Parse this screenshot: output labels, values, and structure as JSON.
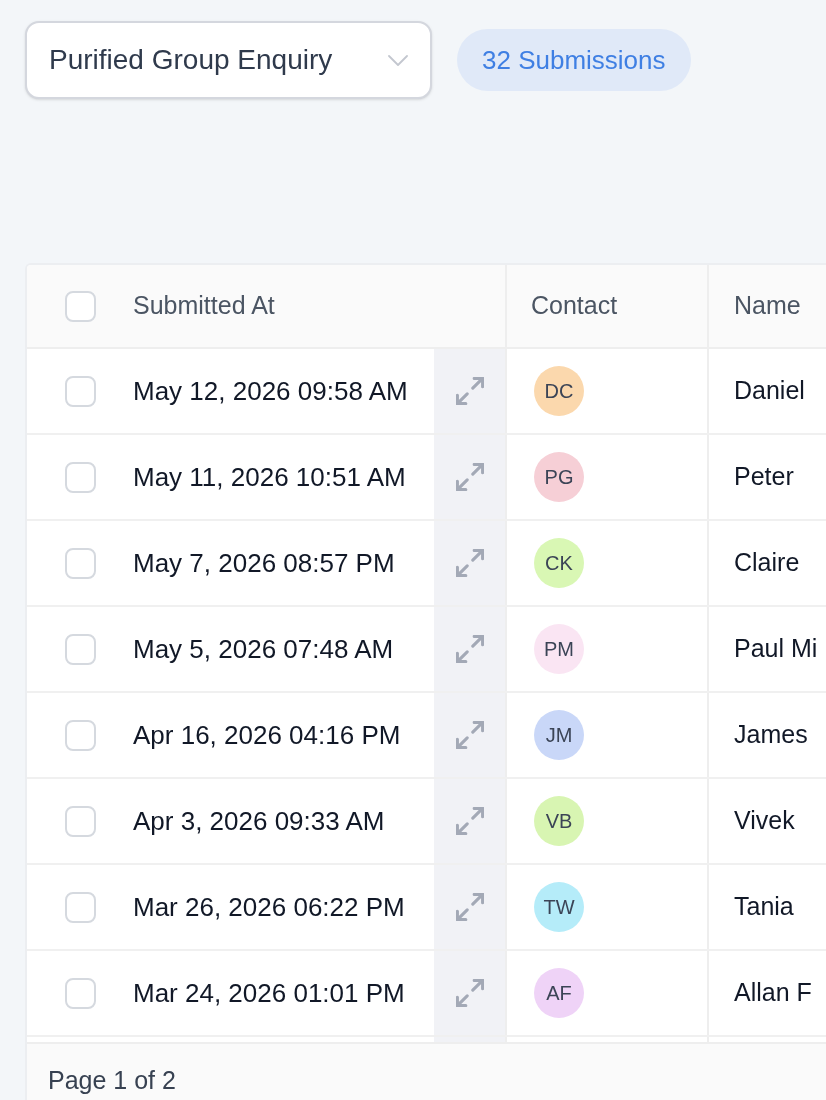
{
  "form_select": {
    "value": "Purified Group Enquiry"
  },
  "submissions_badge": {
    "label": "32 Submissions"
  },
  "table": {
    "select_all": {
      "checked": false
    },
    "columns": [
      {
        "label": "Submitted At"
      },
      {
        "label": "Contact"
      },
      {
        "label": "Name"
      }
    ],
    "rows": [
      {
        "checked": false,
        "submitted_at": "May 12, 2026 09:58 AM",
        "contact": {
          "initials": "DC",
          "color": "#fbd8ad"
        },
        "name": "Daniel"
      },
      {
        "checked": false,
        "submitted_at": "May 11, 2026 10:51 AM",
        "contact": {
          "initials": "PG",
          "color": "#f6cfd6"
        },
        "name": "Peter"
      },
      {
        "checked": false,
        "submitted_at": "May 7, 2026 08:57 PM",
        "contact": {
          "initials": "CK",
          "color": "#d9f7b4"
        },
        "name": "Claire"
      },
      {
        "checked": false,
        "submitted_at": "May 5, 2026 07:48 AM",
        "contact": {
          "initials": "PM",
          "color": "#fae5f3"
        },
        "name": "Paul Mi"
      },
      {
        "checked": false,
        "submitted_at": "Apr 16, 2026 04:16 PM",
        "contact": {
          "initials": "JM",
          "color": "#c9d7f8"
        },
        "name": "James"
      },
      {
        "checked": false,
        "submitted_at": "Apr 3, 2026 09:33 AM",
        "contact": {
          "initials": "VB",
          "color": "#d8f5b2"
        },
        "name": "Vivek"
      },
      {
        "checked": false,
        "submitted_at": "Mar 26, 2026 06:22 PM",
        "contact": {
          "initials": "TW",
          "color": "#b5ecf9"
        },
        "name": "Tania"
      },
      {
        "checked": false,
        "submitted_at": "Mar 24, 2026 01:01 PM",
        "contact": {
          "initials": "AF",
          "color": "#efd3f7"
        },
        "name": "Allan F"
      }
    ]
  },
  "footer": {
    "page_label": "Page 1 of 2"
  }
}
